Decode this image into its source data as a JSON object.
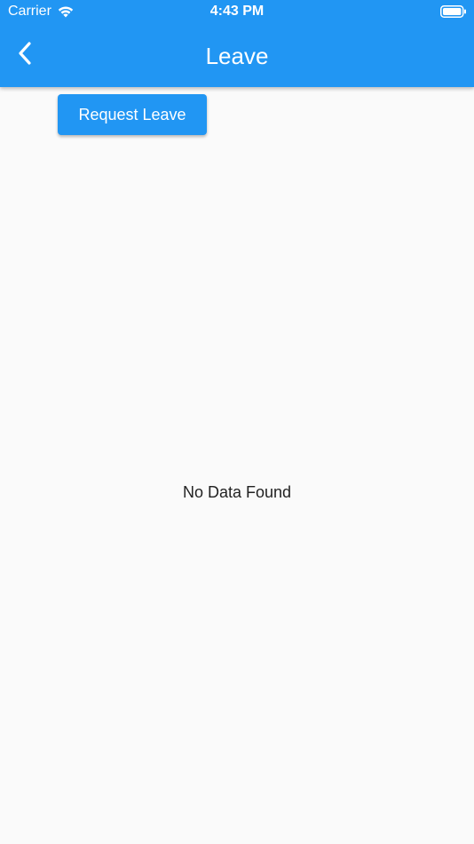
{
  "status_bar": {
    "carrier": "Carrier",
    "time": "4:43 PM"
  },
  "app_bar": {
    "title": "Leave"
  },
  "actions": {
    "request_leave_label": "Request Leave"
  },
  "content": {
    "empty_message": "No Data Found"
  },
  "colors": {
    "primary": "#2196f3",
    "background": "#fafafa"
  },
  "icons": {
    "back": "chevron-left-icon",
    "wifi": "wifi-icon",
    "battery": "battery-icon"
  }
}
